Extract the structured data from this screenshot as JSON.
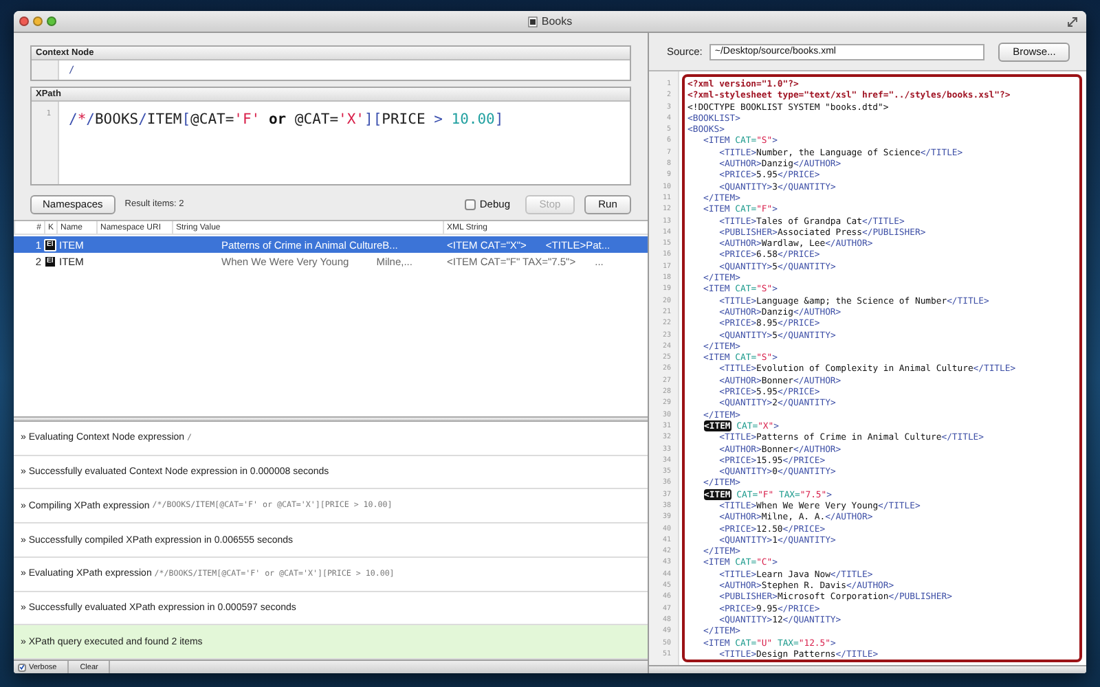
{
  "window": {
    "title": "Books"
  },
  "context_node": {
    "label": "Context Node",
    "value": "/"
  },
  "xpath": {
    "label": "XPath",
    "line_number": "1",
    "tokens": [
      {
        "t": "/",
        "kind": "op"
      },
      {
        "t": "*",
        "kind": "wildcard"
      },
      {
        "t": "/",
        "kind": "op"
      },
      {
        "t": "BOOKS",
        "kind": "name"
      },
      {
        "t": "/",
        "kind": "op"
      },
      {
        "t": "ITEM",
        "kind": "name"
      },
      {
        "t": "[",
        "kind": "op"
      },
      {
        "t": "@CAT=",
        "kind": "name"
      },
      {
        "t": "'F'",
        "kind": "string"
      },
      {
        "t": " or ",
        "kind": "keyword"
      },
      {
        "t": "@CAT=",
        "kind": "name"
      },
      {
        "t": "'X'",
        "kind": "string"
      },
      {
        "t": "][",
        "kind": "op"
      },
      {
        "t": "PRICE ",
        "kind": "name"
      },
      {
        "t": "> ",
        "kind": "op"
      },
      {
        "t": "10.00",
        "kind": "number"
      },
      {
        "t": "]",
        "kind": "op"
      }
    ]
  },
  "toolbar": {
    "namespaces_button": "Namespaces",
    "result_count": "Result items: 2",
    "debug": {
      "label": "Debug",
      "checked": false
    },
    "stop_button": {
      "label": "Stop",
      "disabled": true
    },
    "run_button": {
      "label": "Run",
      "disabled": false
    }
  },
  "results": {
    "columns": [
      "#",
      "K",
      "Name",
      "Namespace URI",
      "String Value",
      "XML String"
    ],
    "rows": [
      {
        "index": "1",
        "k": "El",
        "name": "ITEM",
        "string_value": [
          "Patterns of Crime in Animal CultureB..."
        ],
        "xml_string": [
          "<ITEM CAT=\"X\">",
          "<TITLE>Pat..."
        ],
        "selected": true
      },
      {
        "index": "2",
        "k": "El",
        "name": "ITEM",
        "string_value": [
          "When We Were Very Young",
          "Milne,..."
        ],
        "xml_string": [
          "<ITEM CAT=\"F\" TAX=\"7.5\">",
          "..."
        ],
        "selected": false
      }
    ]
  },
  "log": [
    {
      "text": "» Evaluating Context Node expression",
      "code": "/",
      "kind": "info"
    },
    {
      "text": "» Successfully evaluated Context Node expression in 0.000008 seconds",
      "kind": "info"
    },
    {
      "text": "» Compiling XPath expression",
      "code": "/*/BOOKS/ITEM[@CAT='F' or @CAT='X'][PRICE > 10.00]",
      "kind": "info"
    },
    {
      "text": "» Successfully compiled XPath expression in 0.006555 seconds",
      "kind": "info"
    },
    {
      "text": "» Evaluating XPath expression",
      "code": "/*/BOOKS/ITEM[@CAT='F' or @CAT='X'][PRICE > 10.00]",
      "kind": "info"
    },
    {
      "text": "» Successfully evaluated XPath expression in 0.000597 seconds",
      "kind": "info"
    },
    {
      "text": "» XPath query executed and found 2 items",
      "kind": "result"
    }
  ],
  "log_bar": {
    "verbose": {
      "label": "Verbose",
      "checked": true
    },
    "clear_button": "Clear"
  },
  "source": {
    "label": "Source:",
    "value": "~/Desktop/source/books.xml",
    "browse_button": "Browse..."
  },
  "xml": {
    "lines": [
      {
        "n": "1",
        "text": "<?xml version=\"1.0\"?>",
        "kind": "pi"
      },
      {
        "n": "2",
        "text": "<?xml-stylesheet type=\"text/xsl\" href=\"../styles/books.xsl\"?>",
        "kind": "pi"
      },
      {
        "n": "3",
        "text": "<!DOCTYPE BOOKLIST SYSTEM \"books.dtd\">",
        "kind": "doctype"
      },
      {
        "n": "4",
        "text": "<BOOKLIST>",
        "kind": "element",
        "matched": false
      },
      {
        "n": "5",
        "text": "<BOOKS>",
        "kind": "element",
        "matched": false
      },
      {
        "n": "6",
        "text": "   <ITEM CAT=\"S\">",
        "kind": "element",
        "matched": false
      },
      {
        "n": "7",
        "text": "      <TITLE>Number, the Language of Science</TITLE>",
        "kind": "element",
        "matched": false
      },
      {
        "n": "8",
        "text": "      <AUTHOR>Danzig</AUTHOR>",
        "kind": "element",
        "matched": false
      },
      {
        "n": "9",
        "text": "      <PRICE>5.95</PRICE>",
        "kind": "element",
        "matched": false
      },
      {
        "n": "10",
        "text": "      <QUANTITY>3</QUANTITY>",
        "kind": "element",
        "matched": false
      },
      {
        "n": "11",
        "text": "   </ITEM>",
        "kind": "element",
        "matched": false
      },
      {
        "n": "12",
        "text": "   <ITEM CAT=\"F\">",
        "kind": "element",
        "matched": false
      },
      {
        "n": "13",
        "text": "      <TITLE>Tales of Grandpa Cat</TITLE>",
        "kind": "element",
        "matched": false
      },
      {
        "n": "14",
        "text": "      <PUBLISHER>Associated Press</PUBLISHER>",
        "kind": "element",
        "matched": false
      },
      {
        "n": "15",
        "text": "      <AUTHOR>Wardlaw, Lee</AUTHOR>",
        "kind": "element",
        "matched": false
      },
      {
        "n": "16",
        "text": "      <PRICE>6.58</PRICE>",
        "kind": "element",
        "matched": false
      },
      {
        "n": "17",
        "text": "      <QUANTITY>5</QUANTITY>",
        "kind": "element",
        "matched": false
      },
      {
        "n": "18",
        "text": "   </ITEM>",
        "kind": "element",
        "matched": false
      },
      {
        "n": "19",
        "text": "   <ITEM CAT=\"S\">",
        "kind": "element",
        "matched": false
      },
      {
        "n": "20",
        "text": "      <TITLE>Language &amp; the Science of Number</TITLE>",
        "kind": "element",
        "matched": false
      },
      {
        "n": "21",
        "text": "      <AUTHOR>Danzig</AUTHOR>",
        "kind": "element",
        "matched": false
      },
      {
        "n": "22",
        "text": "      <PRICE>8.95</PRICE>",
        "kind": "element",
        "matched": false
      },
      {
        "n": "23",
        "text": "      <QUANTITY>5</QUANTITY>",
        "kind": "element",
        "matched": false
      },
      {
        "n": "24",
        "text": "   </ITEM>",
        "kind": "element",
        "matched": false
      },
      {
        "n": "25",
        "text": "   <ITEM CAT=\"S\">",
        "kind": "element",
        "matched": false
      },
      {
        "n": "26",
        "text": "      <TITLE>Evolution of Complexity in Animal Culture</TITLE>",
        "kind": "element",
        "matched": false
      },
      {
        "n": "27",
        "text": "      <AUTHOR>Bonner</AUTHOR>",
        "kind": "element",
        "matched": false
      },
      {
        "n": "28",
        "text": "      <PRICE>5.95</PRICE>",
        "kind": "element",
        "matched": false
      },
      {
        "n": "29",
        "text": "      <QUANTITY>2</QUANTITY>",
        "kind": "element",
        "matched": false
      },
      {
        "n": "30",
        "text": "   </ITEM>",
        "kind": "element",
        "matched": false
      },
      {
        "n": "31",
        "text": "   <ITEM CAT=\"X\">",
        "kind": "element",
        "matched": true
      },
      {
        "n": "32",
        "text": "      <TITLE>Patterns of Crime in Animal Culture</TITLE>",
        "kind": "element",
        "matched": false
      },
      {
        "n": "33",
        "text": "      <AUTHOR>Bonner</AUTHOR>",
        "kind": "element",
        "matched": false
      },
      {
        "n": "34",
        "text": "      <PRICE>15.95</PRICE>",
        "kind": "element",
        "matched": false
      },
      {
        "n": "35",
        "text": "      <QUANTITY>0</QUANTITY>",
        "kind": "element",
        "matched": false
      },
      {
        "n": "36",
        "text": "   </ITEM>",
        "kind": "element",
        "matched": false
      },
      {
        "n": "37",
        "text": "   <ITEM CAT=\"F\" TAX=\"7.5\">",
        "kind": "element",
        "matched": true
      },
      {
        "n": "38",
        "text": "      <TITLE>When We Were Very Young</TITLE>",
        "kind": "element",
        "matched": false
      },
      {
        "n": "39",
        "text": "      <AUTHOR>Milne, A. A.</AUTHOR>",
        "kind": "element",
        "matched": false
      },
      {
        "n": "40",
        "text": "      <PRICE>12.50</PRICE>",
        "kind": "element",
        "matched": false
      },
      {
        "n": "41",
        "text": "      <QUANTITY>1</QUANTITY>",
        "kind": "element",
        "matched": false
      },
      {
        "n": "42",
        "text": "   </ITEM>",
        "kind": "element",
        "matched": false
      },
      {
        "n": "43",
        "text": "   <ITEM CAT=\"C\">",
        "kind": "element",
        "matched": false
      },
      {
        "n": "44",
        "text": "      <TITLE>Learn Java Now</TITLE>",
        "kind": "element",
        "matched": false
      },
      {
        "n": "45",
        "text": "      <AUTHOR>Stephen R. Davis</AUTHOR>",
        "kind": "element",
        "matched": false
      },
      {
        "n": "46",
        "text": "      <PUBLISHER>Microsoft Corporation</PUBLISHER>",
        "kind": "element",
        "matched": false
      },
      {
        "n": "47",
        "text": "      <PRICE>9.95</PRICE>",
        "kind": "element",
        "matched": false
      },
      {
        "n": "48",
        "text": "      <QUANTITY>12</QUANTITY>",
        "kind": "element",
        "matched": false
      },
      {
        "n": "49",
        "text": "   </ITEM>",
        "kind": "element",
        "matched": false
      },
      {
        "n": "50",
        "text": "   <ITEM CAT=\"U\" TAX=\"12.5\">",
        "kind": "element",
        "matched": false
      },
      {
        "n": "51",
        "text": "      <TITLE>Design Patterns</TITLE>",
        "kind": "element",
        "matched": false
      }
    ]
  }
}
